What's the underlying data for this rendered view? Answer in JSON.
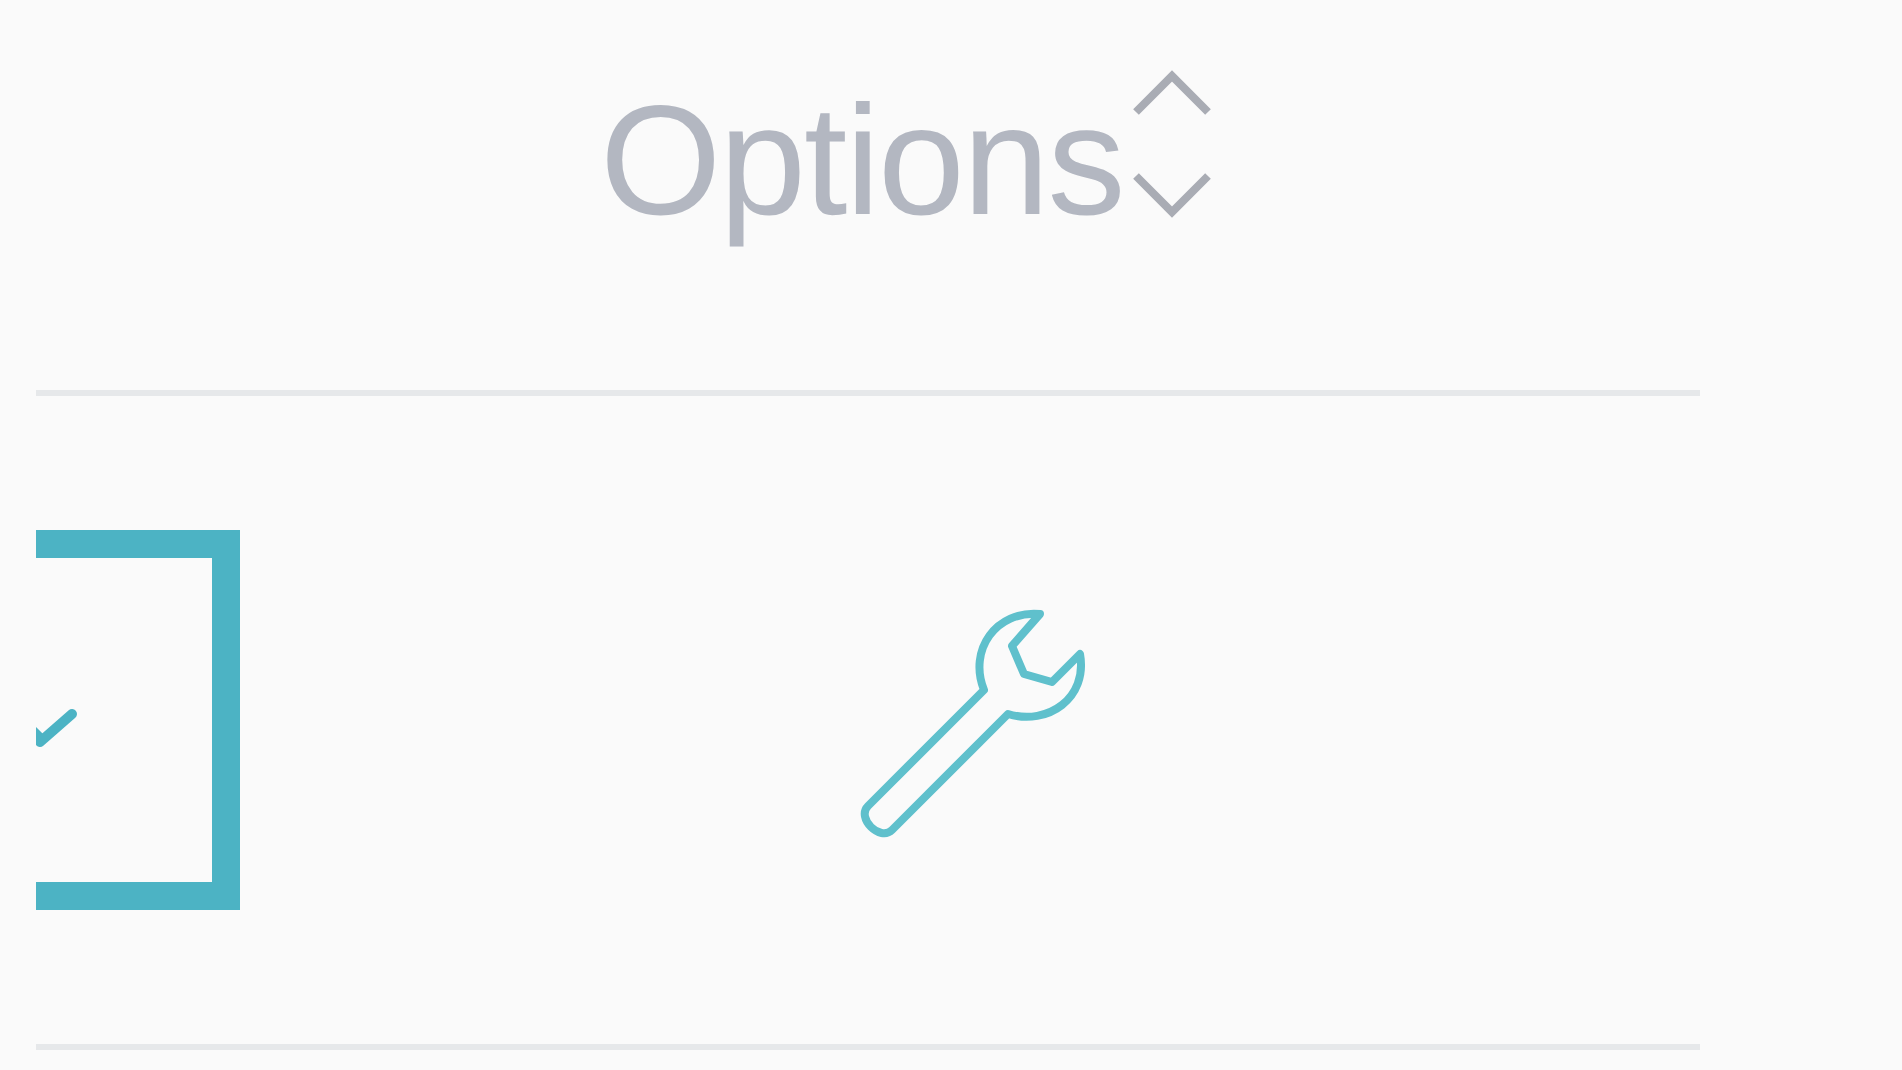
{
  "table": {
    "header": {
      "label": "Options",
      "sortable": true
    },
    "rows": [
      {
        "checked": true
      }
    ]
  }
}
